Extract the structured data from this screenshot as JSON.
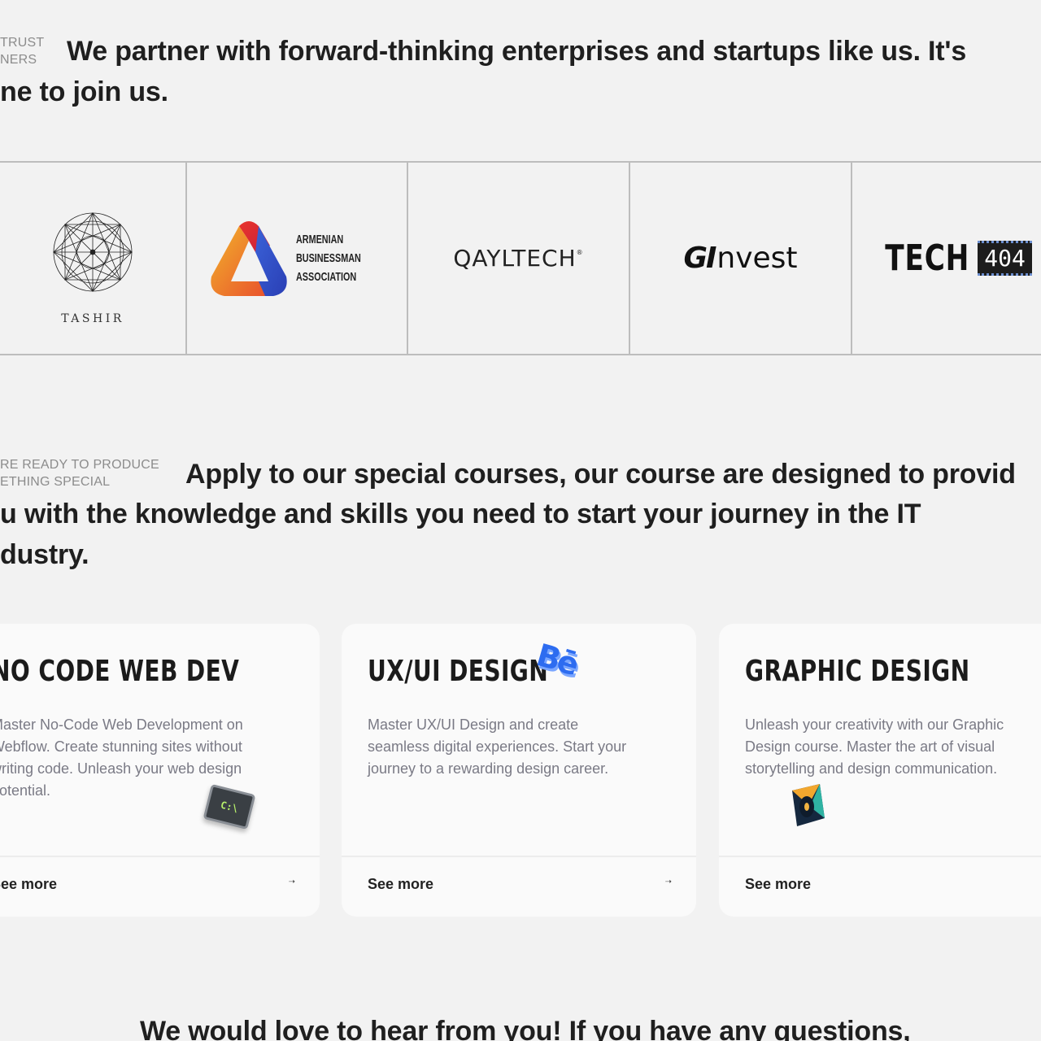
{
  "partners_section": {
    "eyebrow_line1": "TRUST",
    "eyebrow_line2": "NERS",
    "lead_line1": "We partner with forward-thinking enterprises and startups like us. It's",
    "lead_line2": "ne to join us.",
    "logos": [
      {
        "name": "tashir",
        "text": "TASHIR"
      },
      {
        "name": "armenian-businessman-association",
        "line1": "ARMENIAN",
        "line2": "BUSINESSMAN",
        "line3": "ASSOCIATION"
      },
      {
        "name": "qayltech",
        "text": "QAYLTECH",
        "mark": "®"
      },
      {
        "name": "ginvest",
        "prefix": "GI",
        "text": "nvest"
      },
      {
        "name": "tech404",
        "word": "TECH",
        "box": "404"
      }
    ]
  },
  "courses_section": {
    "eyebrow_line1": "RE READY TO PRODUCE",
    "eyebrow_line2": "ETHING SPECIAL",
    "lead_line1": "Apply to our special courses, our course are designed to provid",
    "lead_line2": "u with the knowledge and skills you need to start your journey in the IT",
    "lead_line3": "dustry.",
    "cards": [
      {
        "title": "NO CODE WEB DEV",
        "desc_line1": "Master No-Code Web Development on",
        "desc_line2": "Webflow. Create stunning sites without",
        "desc_line3": "writing code. Unleash your web design",
        "desc_line4": "potential.",
        "more": "See more",
        "arrow": "➝",
        "icon": "terminal-icon",
        "icon_text": "C:\\"
      },
      {
        "title": "UX/UI DESIGN",
        "desc_line1": "Master UX/UI Design and create",
        "desc_line2": "seamless digital experiences. Start your",
        "desc_line3": "journey to a rewarding design career.",
        "more": "See more",
        "arrow": "➝",
        "icon": "behance-icon",
        "icon_text": "Bē"
      },
      {
        "title": "GRAPHIC DESIGN",
        "desc_line1": "Unleash your creativity with our Graphic",
        "desc_line2": "Design course. Master the art of visual",
        "desc_line3": "storytelling and design communication.",
        "more": "See more",
        "icon": "graphic-design-icon"
      }
    ]
  },
  "contact_section": {
    "lead_line1": "We would love to hear from you! If you have any questions,"
  },
  "colors": {
    "background": "#f2f2f2",
    "card": "#fafafa",
    "muted_text": "#7a7a85",
    "divider": "#bdbdbd"
  }
}
